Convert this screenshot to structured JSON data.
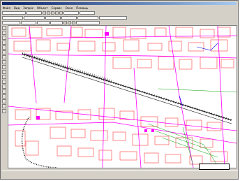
{
  "menu": {
    "items": [
      "Файл",
      "Вид",
      "Запрос",
      "Объект",
      "Сервис",
      "Окно",
      "Помощь"
    ]
  },
  "toolbar": {
    "row1": [
      "",
      "",
      "",
      ""
    ],
    "row2": [
      "",
      "",
      "",
      "",
      "",
      ""
    ],
    "row3": [
      "",
      "",
      "",
      "",
      ""
    ],
    "row4": [
      "",
      ""
    ]
  },
  "status": {
    "fields": [
      "",
      "",
      "",
      ""
    ]
  },
  "map": {
    "label": ""
  },
  "colors": {
    "road": "#ff00ff",
    "building": "#ff3b3b",
    "rail": "#101010",
    "parcel": "#00a000",
    "water": "#0000ff"
  }
}
